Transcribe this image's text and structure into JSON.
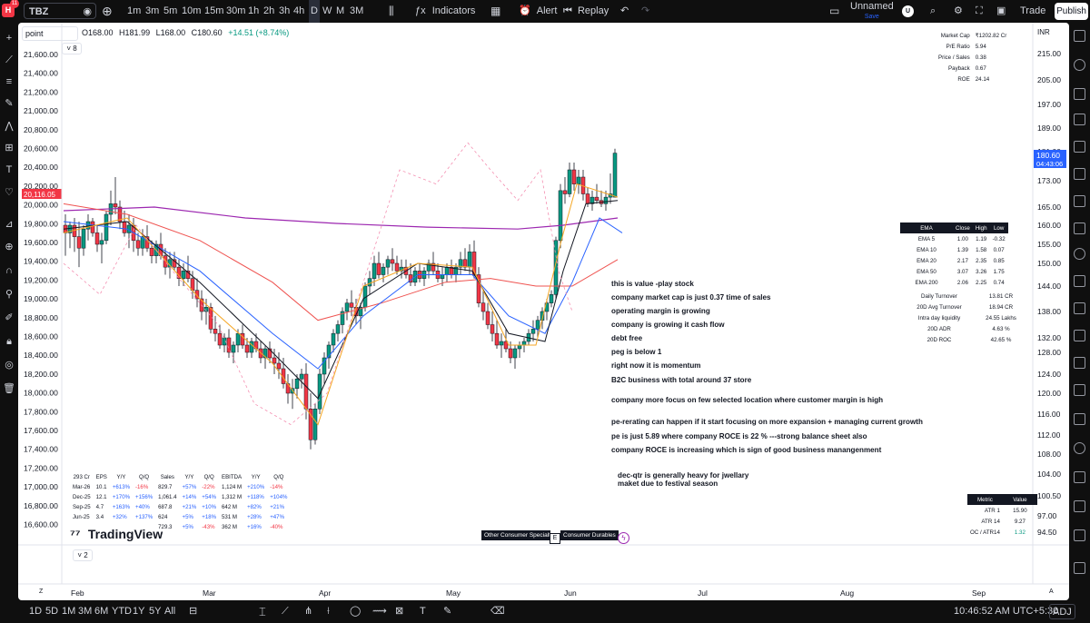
{
  "topbar": {
    "symbol": "TBZ",
    "badge": "11",
    "timeframes": [
      "1m",
      "3m",
      "5m",
      "10m",
      "15m",
      "30m",
      "1h",
      "2h",
      "3h",
      "4h",
      "D",
      "W",
      "M",
      "3M"
    ],
    "active_timeframe": "D",
    "indicators_label": "Indicators",
    "alert_label": "Alert",
    "replay_label": "Replay",
    "layout_name": "Unnamed",
    "layout_sub": "Save",
    "avatar": "U",
    "trade_label": "Trade",
    "publish_label": "Publish"
  },
  "legend": {
    "scale_mode": "point",
    "open": "O168.00",
    "high": "H181.99",
    "low": "L168.00",
    "close": "C180.60",
    "change": "+14.51 (+8.74%)",
    "indicator_count": "8",
    "pane_count": "2"
  },
  "left_axis": {
    "labels": [
      "21,600.00",
      "21,400.00",
      "21,200.00",
      "21,000.00",
      "20,800.00",
      "20,600.00",
      "20,400.00",
      "20,200.00",
      "20,000.00",
      "19,800.00",
      "19,600.00",
      "19,400.00",
      "19,200.00",
      "19,000.00",
      "18,800.00",
      "18,600.00",
      "18,400.00",
      "18,200.00",
      "18,000.00",
      "17,800.00",
      "17,600.00",
      "17,400.00",
      "17,200.00",
      "17,000.00",
      "16,800.00",
      "16,600.00"
    ],
    "marker": "20,116.05"
  },
  "right_axis": {
    "currency": "INR",
    "labels": [
      "215.00",
      "205.00",
      "197.00",
      "189.00",
      "181.00",
      "173.00",
      "165.00",
      "160.00",
      "155.00",
      "150.00",
      "144.00",
      "138.00",
      "132.00",
      "128.00",
      "124.00",
      "120.00",
      "116.00",
      "112.00",
      "108.00",
      "104.00",
      "100.50",
      "97.00",
      "94.50"
    ],
    "price_tag": "180.60",
    "countdown": "04:43:06"
  },
  "time_axis": {
    "labels": [
      "Feb",
      "Mar",
      "Apr",
      "May",
      "Jun",
      "Jul",
      "Aug",
      "Sep"
    ]
  },
  "fundamentals": [
    {
      "k": "Market Cap",
      "v": "₹1202.82 Cr"
    },
    {
      "k": "P/E Ratio",
      "v": "5.94"
    },
    {
      "k": "Price / Sales",
      "v": "0.38"
    },
    {
      "k": "Payback",
      "v": "0.67"
    },
    {
      "k": "ROE",
      "v": "24.14"
    }
  ],
  "ema_table": {
    "headers": [
      "EMA",
      "Close",
      "High",
      "Low"
    ],
    "rows": [
      [
        "EMA 5",
        "1.00",
        "1.19",
        "-0.32"
      ],
      [
        "EMA 10",
        "1.39",
        "1.58",
        "0.07"
      ],
      [
        "EMA 20",
        "2.17",
        "2.35",
        "0.85"
      ],
      [
        "EMA 50",
        "3.07",
        "3.26",
        "1.75"
      ],
      [
        "EMA 200",
        "2.06",
        "2.25",
        "0.74"
      ]
    ],
    "extra": [
      {
        "k": "Daily Turnover",
        "v": "13.81 CR"
      },
      {
        "k": "20D Avg Turnover",
        "v": "18.94 CR"
      },
      {
        "k": "Intra day liquidity",
        "v": "24.55 Lakhs"
      },
      {
        "k": "20D ADR",
        "v": "4.63 %"
      },
      {
        "k": "20D ROC",
        "v": "42.65 %"
      }
    ]
  },
  "metric_table": {
    "headers": [
      "Metric",
      "Value"
    ],
    "rows": [
      [
        "ATR 1",
        "15.90"
      ],
      [
        "ATR 14",
        "9.27"
      ],
      [
        "OC / ATR14",
        "1.32"
      ]
    ]
  },
  "results_table": {
    "headers": [
      "293 Cr",
      "EPS",
      "Y/Y",
      "Q/Q",
      "Sales",
      "Y/Y",
      "Q/Q",
      "EBITDA",
      "Y/Y",
      "Q/Q"
    ],
    "rows": [
      [
        "Mar-26",
        "10.1",
        "+613%",
        "-16%",
        "829.7",
        "+57%",
        "-22%",
        "1,124 M",
        "+210%",
        "-14%"
      ],
      [
        "Dec-25",
        "12.1",
        "+170%",
        "+156%",
        "1,061.4",
        "+14%",
        "+54%",
        "1,312 M",
        "+118%",
        "+104%"
      ],
      [
        "Sep-25",
        "4.7",
        "+163%",
        "+40%",
        "687.8",
        "+21%",
        "+10%",
        "642 M",
        "+82%",
        "+21%"
      ],
      [
        "Jun-25",
        "3.4",
        "+32%",
        "+137%",
        "624",
        "+5%",
        "+18%",
        "531 M",
        "+28%",
        "+47%"
      ],
      [
        "",
        "",
        "",
        "",
        "729.3",
        "+5%",
        "-43%",
        "362 M",
        "+16%",
        "-40%"
      ]
    ]
  },
  "notes": [
    "this is value -play stock",
    "company market cap is just 0.37 time of sales",
    "operating margin is growing",
    "company is growing it cash flow",
    "debt free",
    "peg is below 1",
    "right now it is momentum",
    "B2C business with total around 37 store",
    "company more focus on few selected location where customer margin is high",
    "pe-rerating can happen if it start focusing on more expansion + managing current growth",
    "pe is just 5.89 where company ROCE is   22 % ---strong balance sheet also",
    "company ROCE is increasing which is sign of good business manangenment",
    "dec-qtr is generally heavy for jwellary",
    "maket due to festival season"
  ],
  "sector_tags": [
    "Other Consumer Specialties",
    "Consumer Durables"
  ],
  "e_badge": "E",
  "watermark": "TradingView",
  "bottombar": {
    "ranges": [
      "1D",
      "5D",
      "1M",
      "3M",
      "6M",
      "YTD",
      "1Y",
      "5Y",
      "All"
    ],
    "clock": "10:46:52 AM UTC+5:30",
    "adj": "ADJ"
  },
  "colors": {
    "up": "#089981",
    "down": "#f23645",
    "ema5": "#f5a623",
    "ema10": "#131722",
    "ema20": "#2962ff",
    "ema50": "#ef5350",
    "ema200": "#9c27b0",
    "index": "#f48fb1"
  }
}
